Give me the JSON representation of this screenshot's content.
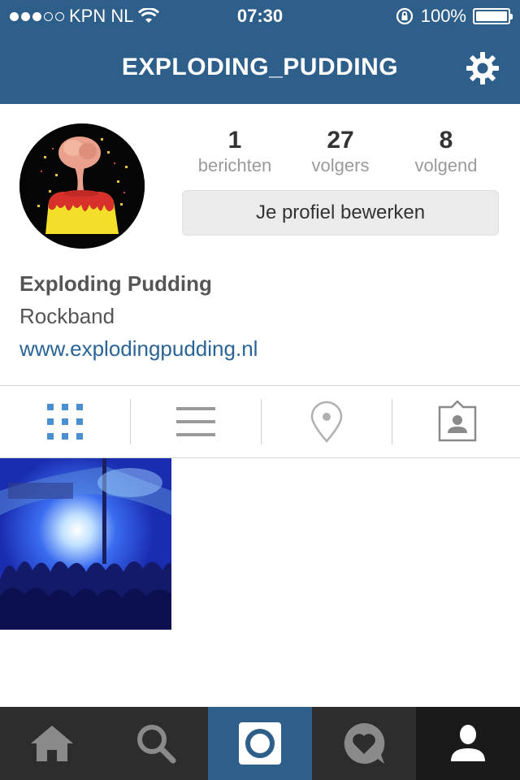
{
  "status_bar": {
    "carrier": "KPN NL",
    "time": "07:30",
    "battery": "100%",
    "battery_level": 1.0,
    "signal_bars_filled": 3,
    "signal_bars_total": 5
  },
  "header": {
    "username": "EXPLODING_PUDDING",
    "settings_icon": "gear-icon"
  },
  "profile": {
    "stats": [
      {
        "value": "1",
        "label": "berichten"
      },
      {
        "value": "27",
        "label": "volgers"
      },
      {
        "value": "8",
        "label": "volgend"
      }
    ],
    "edit_button": "Je profiel bewerken",
    "name": "Exploding Pudding",
    "bio": "Rockband",
    "website": "www.explodingpudding.nl"
  },
  "tabs": [
    {
      "icon": "grid-icon",
      "active": true
    },
    {
      "icon": "list-icon",
      "active": false
    },
    {
      "icon": "location-pin-icon",
      "active": false
    },
    {
      "icon": "tagged-person-icon",
      "active": false
    }
  ],
  "bottom_nav": [
    {
      "icon": "home-icon"
    },
    {
      "icon": "search-icon"
    },
    {
      "icon": "camera-icon"
    },
    {
      "icon": "activity-heart-icon"
    },
    {
      "icon": "profile-icon",
      "active": true
    }
  ],
  "colors": {
    "header_bg": "#2e5e8a",
    "link": "#2a6496",
    "active_tab": "#4a90d0",
    "nav_bg": "#2d2d2d"
  }
}
